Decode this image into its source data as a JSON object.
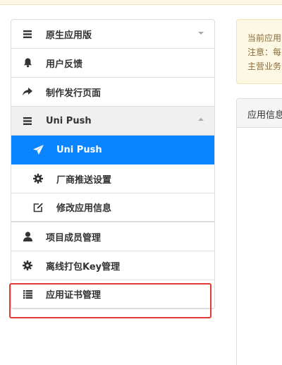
{
  "sidebar": {
    "items": [
      {
        "label": "原生应用版",
        "icon": "list-icon"
      },
      {
        "label": "用户反馈",
        "icon": "bell-icon"
      },
      {
        "label": "制作发行页面",
        "icon": "share-arrow-icon"
      },
      {
        "label": "Uni Push",
        "icon": "list-icon"
      },
      {
        "label": "Uni Push",
        "icon": "send-icon"
      },
      {
        "label": "厂商推送设置",
        "icon": "gear-icon"
      },
      {
        "label": "修改应用信息",
        "icon": "edit-icon"
      },
      {
        "label": "项目成员管理",
        "icon": "user-icon"
      },
      {
        "label": "离线打包Key管理",
        "icon": "gear-icon"
      },
      {
        "label": "应用证书管理",
        "icon": "list-bullet-icon"
      }
    ]
  },
  "notice": {
    "line1": "当前应用",
    "line2": "注意：每",
    "line3": "主营业务"
  },
  "panel": {
    "title": "应用信息"
  },
  "colors": {
    "active_bg": "#0a84ff",
    "highlight_border": "#e53935",
    "notice_bg": "#fcf8e3",
    "notice_text": "#8a6d3b"
  }
}
